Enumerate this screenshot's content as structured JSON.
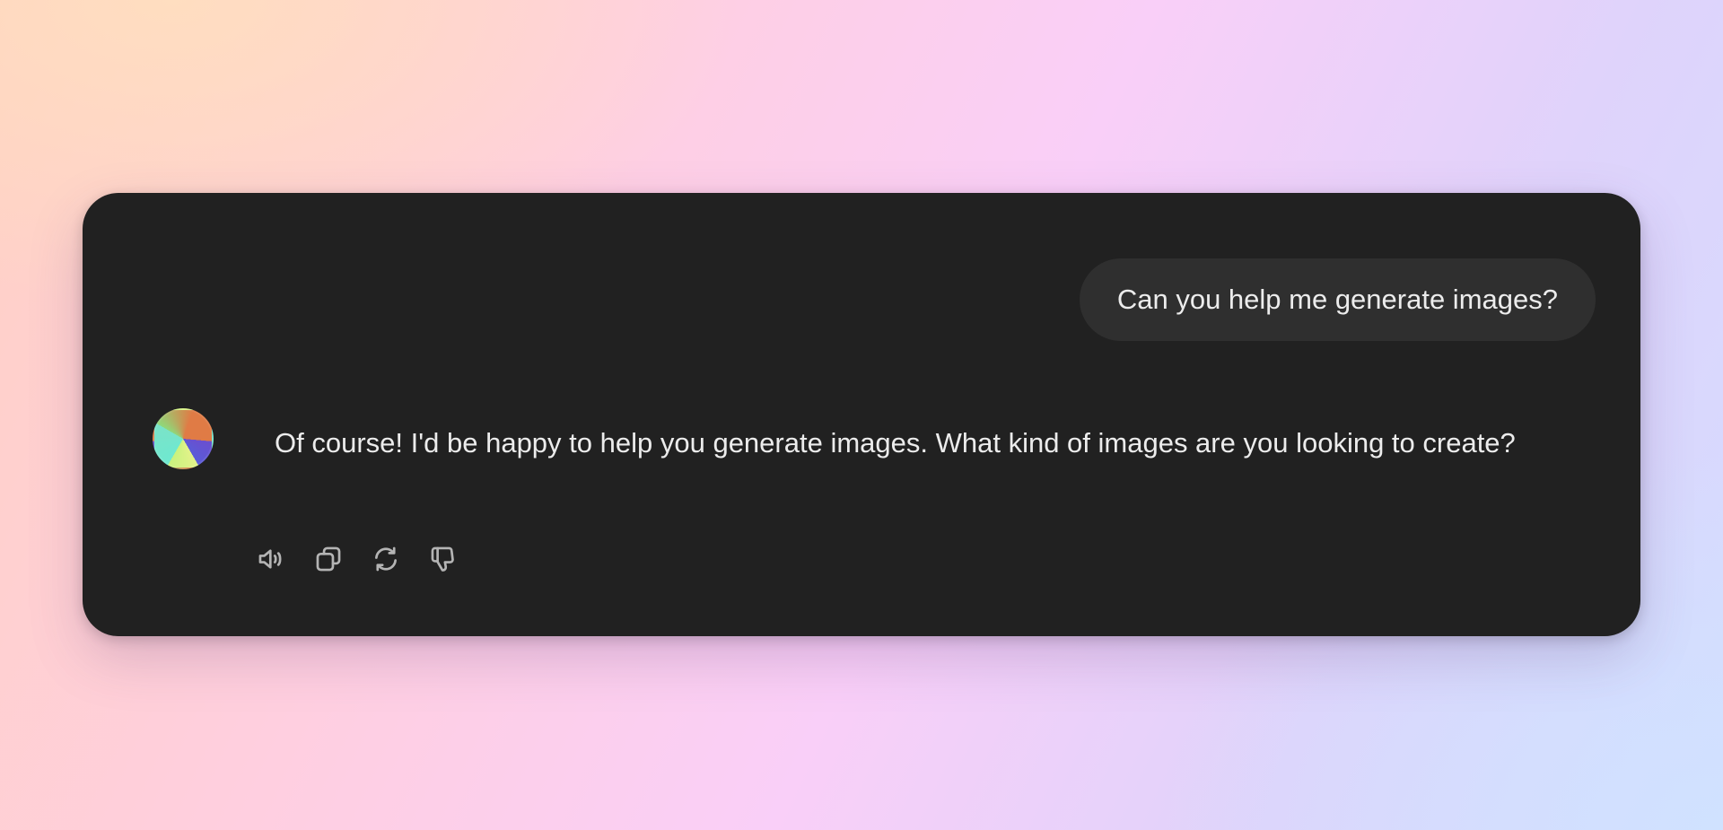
{
  "conversation": {
    "user_message": "Can you help me generate images?",
    "assistant_message": "Of course! I'd be happy to help you generate images. What kind of images are you looking to create?",
    "actions": [
      {
        "icon": "speaker-icon"
      },
      {
        "icon": "copy-icon"
      },
      {
        "icon": "regenerate-icon"
      },
      {
        "icon": "thumbs-down-icon"
      }
    ]
  },
  "colors": {
    "card_background": "#212121",
    "user_bubble_background": "#2f2f2f",
    "text": "#ececec",
    "icon": "#b4b4b4"
  }
}
